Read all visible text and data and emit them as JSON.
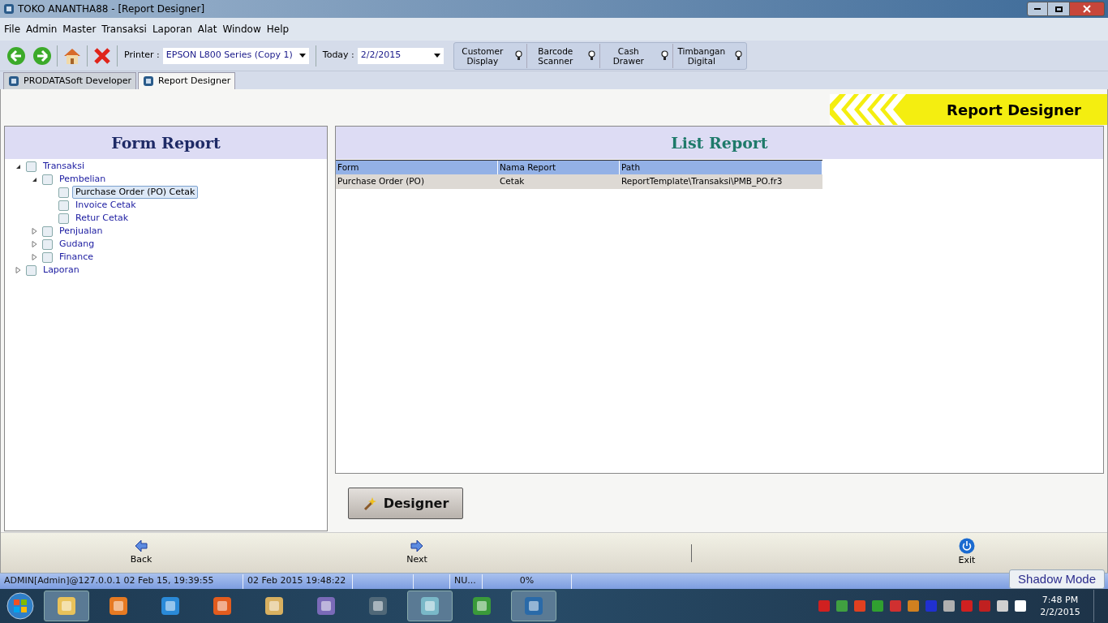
{
  "window": {
    "title": "TOKO ANANTHA88 - [Report Designer]"
  },
  "menu": [
    "File",
    "Admin",
    "Master",
    "Transaksi",
    "Laporan",
    "Alat",
    "Window",
    "Help"
  ],
  "toolbar": {
    "printer_label": "Printer :",
    "printer_value": "EPSON L800 Series (Copy 1)",
    "today_label": "Today :",
    "today_value": "2/2/2015",
    "devices": [
      {
        "label": "Customer Display"
      },
      {
        "label": "Barcode Scanner"
      },
      {
        "label": "Cash Drawer"
      },
      {
        "label": "Timbangan Digital"
      }
    ]
  },
  "tabs": [
    {
      "label": "PRODATASoft Developer",
      "selected": false
    },
    {
      "label": "Report Designer",
      "selected": true
    }
  ],
  "banner": {
    "title": "Report Designer"
  },
  "form_report": {
    "title": "Form Report",
    "tree": [
      {
        "label": "Transaksi",
        "expanded": true,
        "selected": false,
        "children": [
          {
            "label": "Pembelian",
            "expanded": true,
            "selected": false,
            "children": [
              {
                "label": "Purchase Order (PO) Cetak",
                "selected": true
              },
              {
                "label": "Invoice Cetak",
                "selected": false
              },
              {
                "label": "Retur Cetak",
                "selected": false
              }
            ]
          },
          {
            "label": "Penjualan",
            "expanded": false,
            "selected": false
          },
          {
            "label": "Gudang",
            "expanded": false,
            "selected": false
          },
          {
            "label": "Finance",
            "expanded": false,
            "selected": false
          }
        ]
      },
      {
        "label": "Laporan",
        "expanded": false,
        "selected": false
      }
    ]
  },
  "list_report": {
    "title": "List Report",
    "columns": [
      "Form",
      "Nama Report",
      "Path"
    ],
    "rows": [
      {
        "cells": [
          "Purchase Order (PO)",
          "Cetak",
          "ReportTemplate\\Transaksi\\PMB_PO.fr3"
        ],
        "selected": true
      }
    ]
  },
  "designer_button": "Designer",
  "nav": {
    "back": "Back",
    "next": "Next",
    "exit": "Exit"
  },
  "status_bar": [
    "ADMIN[Admin]@127.0.0.1 02 Feb 15, 19:39:55",
    "02 Feb 2015 19:48:22",
    "NU...",
    "0%"
  ],
  "shadow_mode": "Shadow Mode",
  "clock": {
    "time": "7:48 PM",
    "date": "2/2/2015"
  }
}
